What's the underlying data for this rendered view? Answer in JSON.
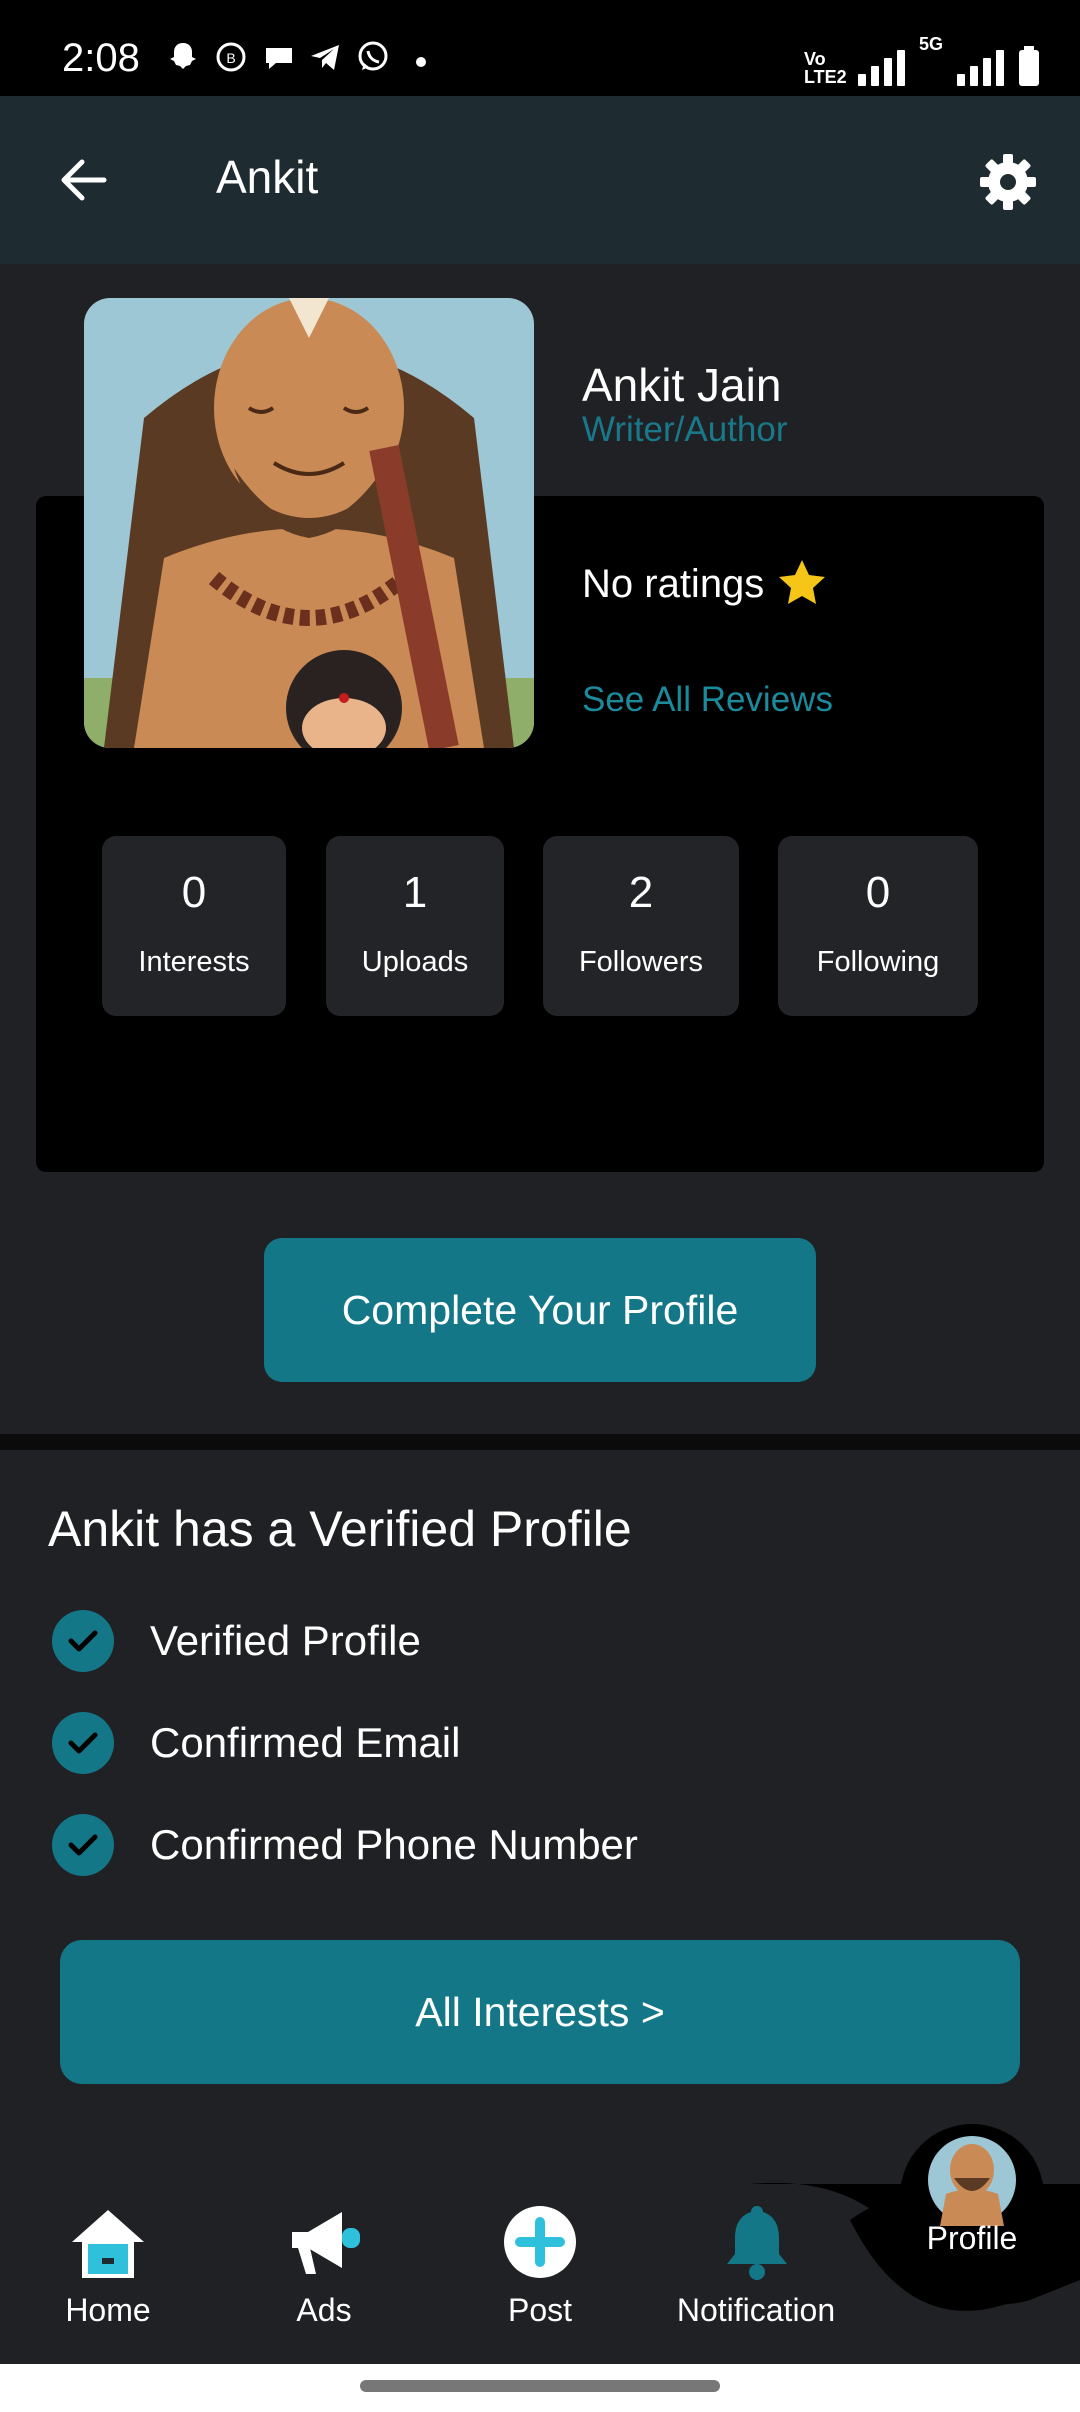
{
  "status_bar": {
    "time": "2:08",
    "network_label": "5G",
    "volte_label": "Vo LTE2"
  },
  "header": {
    "title": "Ankit"
  },
  "profile": {
    "name": "Ankit Jain",
    "role": "Writer/Author",
    "rating": "No ratings",
    "reviews_link": "See All Reviews"
  },
  "stats": [
    {
      "value": "0",
      "label": "Interests"
    },
    {
      "value": "1",
      "label": "Uploads"
    },
    {
      "value": "2",
      "label": "Followers"
    },
    {
      "value": "0",
      "label": "Following"
    }
  ],
  "complete_profile_label": "Complete Your Profile",
  "verified": {
    "heading": "Ankit has a Verified Profile",
    "items": [
      "Verified Profile",
      "Confirmed Email",
      "Confirmed Phone Number"
    ]
  },
  "all_interests_label": "All Interests >",
  "nav": {
    "home": "Home",
    "ads": "Ads",
    "post": "Post",
    "notification": "Notification",
    "profile": "Profile"
  },
  "colors": {
    "accent": "#137788",
    "accent_text": "#19788a",
    "header_bg": "#1e2b30",
    "background": "#202124",
    "card": "#000000",
    "home_icon": "#2fc1dc"
  }
}
